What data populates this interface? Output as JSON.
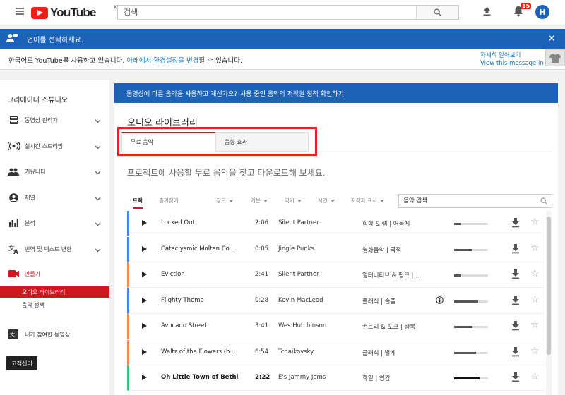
{
  "header": {
    "logo_text": "YouTube",
    "country": "KR",
    "search_placeholder": "검색",
    "notifications_count": "15",
    "avatar_letter": "H"
  },
  "language_banner": {
    "title": "언어를 선택하세요.",
    "close": "×",
    "message_prefix": "한국어로 YouTube를 사용하고 있습니다. ",
    "message_link": "아래에서 환경설정을 변경",
    "message_suffix": "할 수 있습니다.",
    "learn_more": "자세히 알아보기",
    "view_in_english": "View this message in English"
  },
  "sidebar": {
    "title": "크리에이터 스튜디오",
    "items": [
      {
        "label": "동영상 관리자"
      },
      {
        "label": "실시간 스트리밍"
      },
      {
        "label": "커뮤니티"
      },
      {
        "label": "채널"
      },
      {
        "label": "분석"
      },
      {
        "label": "번역 및 텍스트 변환"
      },
      {
        "label": "만들기"
      }
    ],
    "sub_items": [
      {
        "label": "오디오 라이브러리"
      },
      {
        "label": "음악 정책"
      }
    ],
    "contributed_label": "내가 참여한 동영상",
    "help_button": "고객센터"
  },
  "main": {
    "copyright_prefix": "동영상에 다른 음악을 사용하고 계신가요?",
    "copyright_link": "사용 중인 음악의 저작권 정책 확인하기",
    "library_title": "오디오 라이브러리",
    "tabs": [
      {
        "label": "무료 음악"
      },
      {
        "label": "음향 효과"
      }
    ],
    "sub_heading": "프로젝트에 사용할 무료 음악을 찾고 다운로드해 보세요.",
    "filter_tabs": [
      {
        "label": "트랙"
      },
      {
        "label": "즐겨찾기"
      }
    ],
    "filters": [
      {
        "label": "장르"
      },
      {
        "label": "기분"
      },
      {
        "label": "악기"
      },
      {
        "label": "시간"
      },
      {
        "label": "저작자 표시"
      }
    ],
    "music_search_placeholder": "음악 검색",
    "tracks": [
      {
        "title": "Locked Out",
        "duration": "2:06",
        "artist": "Silent Partner",
        "genre": "힙합 & 랩 | 어둡게",
        "popularity": 0.2,
        "stripe": "#4285f4"
      },
      {
        "title": "Cataclysmic Molten Co...",
        "duration": "0:05",
        "artist": "Jingle Punks",
        "genre": "영화음악 | 극적",
        "popularity": 0.55,
        "stripe": "#4285f4"
      },
      {
        "title": "Eviction",
        "duration": "2:41",
        "artist": "Silent Partner",
        "genre": "얼터너티브 & 펑크 | ...",
        "popularity": 0.2,
        "stripe": "#f28b56"
      },
      {
        "title": "Flighty Theme",
        "duration": "0:28",
        "artist": "Kevin MacLeod",
        "genre": "클래식 | 슬픔",
        "popularity": 0.7,
        "stripe": "#4285f4",
        "attribution": true
      },
      {
        "title": "Avocado Street",
        "duration": "3:41",
        "artist": "Wes Hutchinson",
        "genre": "컨트리 & 포크 | 행복",
        "popularity": 0.55,
        "stripe": "#f28b56"
      },
      {
        "title": "Waltz of the Flowers (b...",
        "duration": "6:54",
        "artist": "Tchaikovsky",
        "genre": "클래식 | 밝게",
        "popularity": 0.65,
        "stripe": "#f28b56"
      },
      {
        "title": "Oh Little Town of Bethle...",
        "duration": "2:22",
        "artist": "E's Jammy Jams",
        "genre": "휴일 | 영감",
        "popularity": 0.75,
        "stripe": "#3fbf7f",
        "bold": true
      }
    ]
  }
}
